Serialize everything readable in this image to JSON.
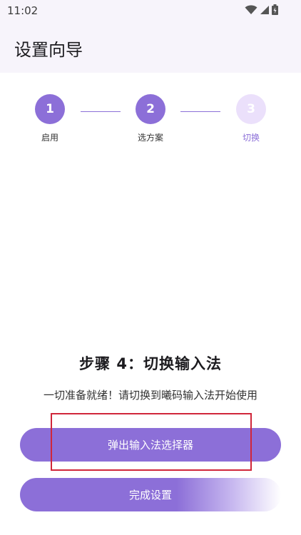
{
  "status_bar": {
    "time": "11:02",
    "icons": [
      "wifi-icon",
      "signal-icon",
      "battery-icon"
    ]
  },
  "app_bar": {
    "title": "设置向导"
  },
  "stepper": {
    "steps": [
      {
        "number": "1",
        "label": "启用",
        "state": "done"
      },
      {
        "number": "2",
        "label": "选方案",
        "state": "done"
      },
      {
        "number": "3",
        "label": "切换",
        "state": "current"
      }
    ]
  },
  "content": {
    "heading": "步骤 4：切换输入法",
    "description": "一切准备就绪！请切换到曦码输入法开始使用"
  },
  "actions": {
    "show_picker_label": "弹出输入法选择器",
    "finish_label": "完成设置"
  },
  "colors": {
    "accent": "#8c6fd8",
    "accent_light": "#ebe0fb",
    "highlight": "#d0263a"
  }
}
